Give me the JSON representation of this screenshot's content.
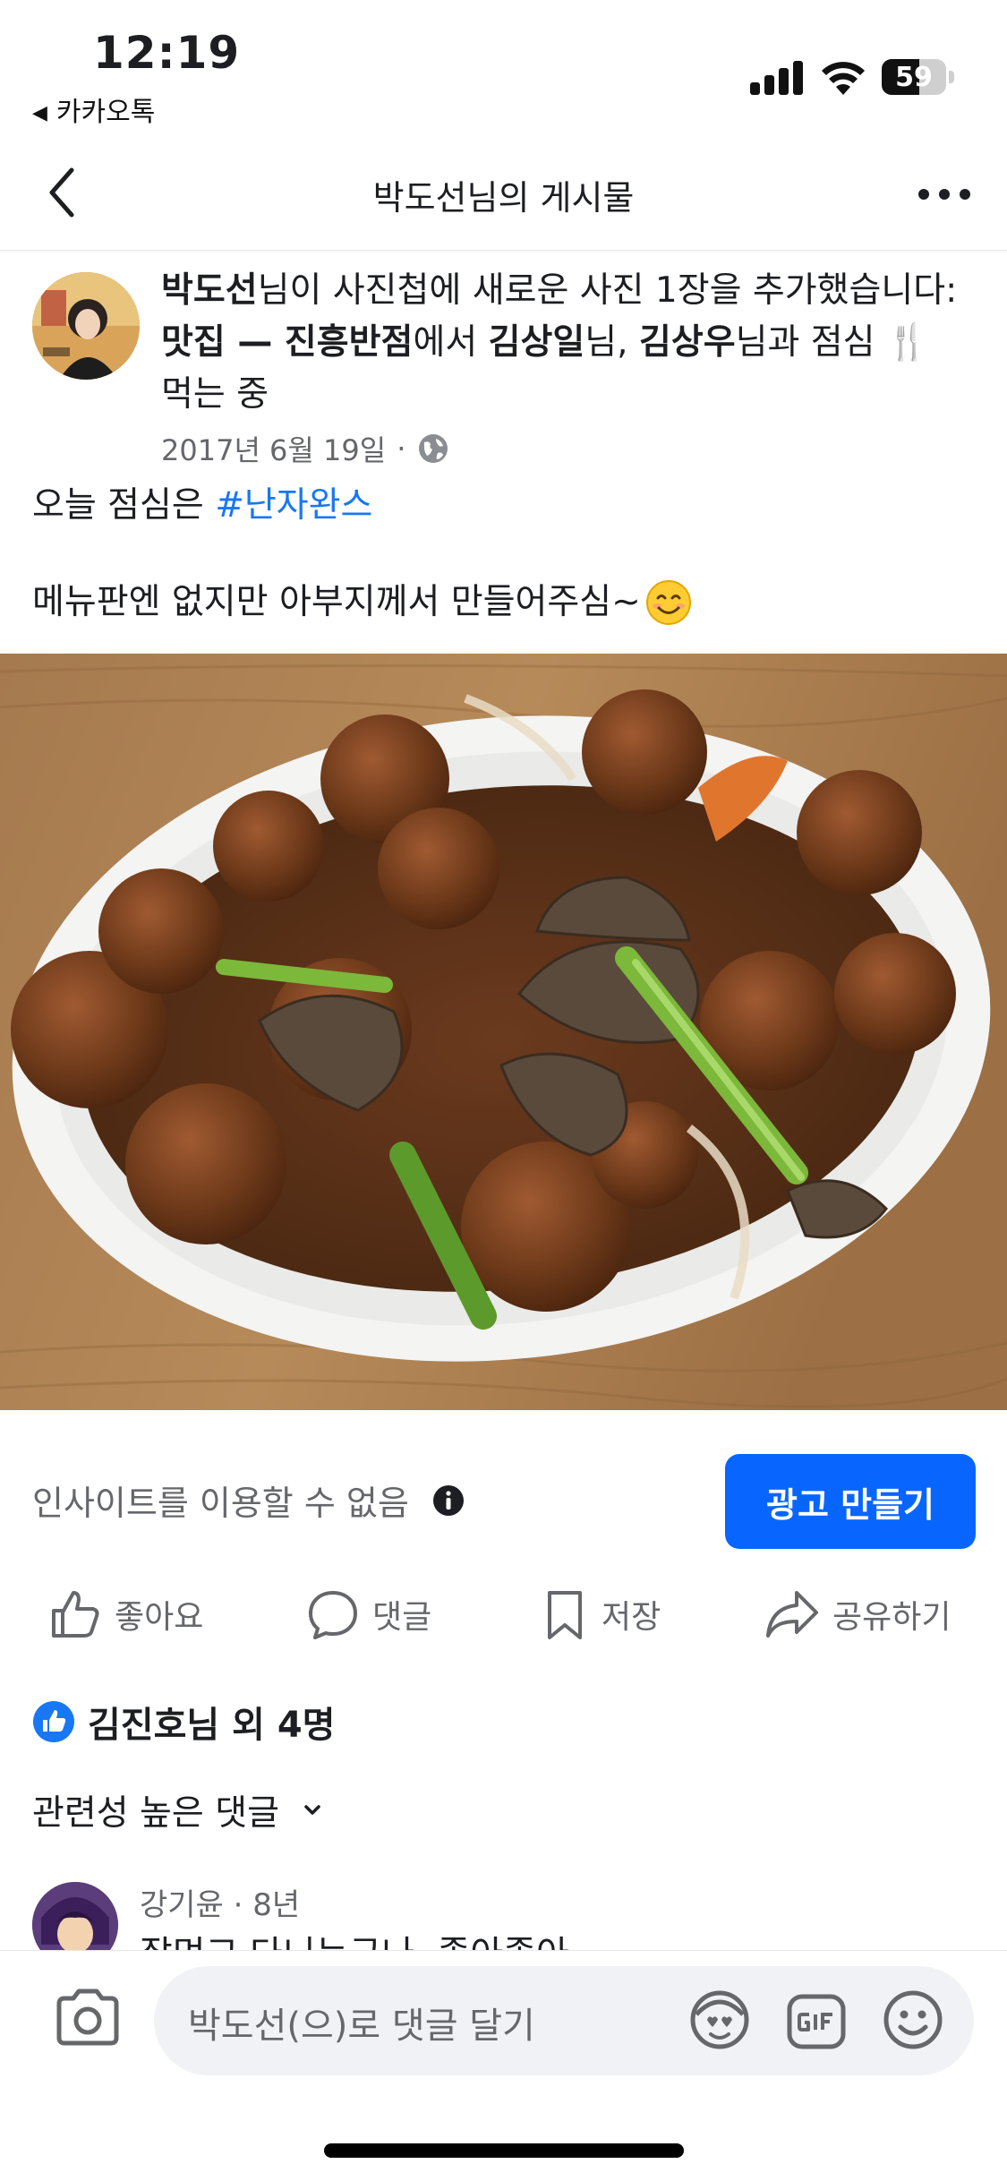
{
  "status_bar": {
    "time": "12:19",
    "back_app": "카카오톡",
    "battery_level": "59"
  },
  "nav": {
    "title": "박도선님의 게시물"
  },
  "post": {
    "author": "박도선",
    "header_part1": "님이 사진첩에 새로운 사진 1장을 추가했습니다: ",
    "album": "맛집 — 진흥반점",
    "header_part2": "에서 ",
    "tag1": "김상일",
    "header_part3": "님, ",
    "tag2": "김상우",
    "header_part4": "님과 점심 🍴 먹는 중",
    "date": "2017년 6월 19일",
    "dot": "·",
    "audience_icon": "globe-icon",
    "text_line1_prefix": "오늘 점심은 ",
    "hashtag": "#난자완스",
    "text_line2": "메뉴판엔 없지만 아부지께서 만들어주심~",
    "emoji": "smiling-face-icon"
  },
  "insights": {
    "label": "인사이트를 이용할 수 없음",
    "info_icon": "info-icon",
    "create_ad_label": "광고 만들기"
  },
  "actions": {
    "like": "좋아요",
    "comment": "댓글",
    "save": "저장",
    "share": "공유하기"
  },
  "reactions": {
    "summary": "김진호님 외 4명"
  },
  "comments": {
    "sort_label": "관련성 높은 댓글",
    "items": [
      {
        "name": "강기윤",
        "separator": "·",
        "age": "8년",
        "text": "잘먹고 다니는구나. 좋아좋아"
      }
    ]
  },
  "composer": {
    "placeholder": "박도선(으)로 댓글 달기"
  },
  "colors": {
    "accent": "#0866ff",
    "hashtag": "#1877f2",
    "secondary_text": "#65676b"
  }
}
